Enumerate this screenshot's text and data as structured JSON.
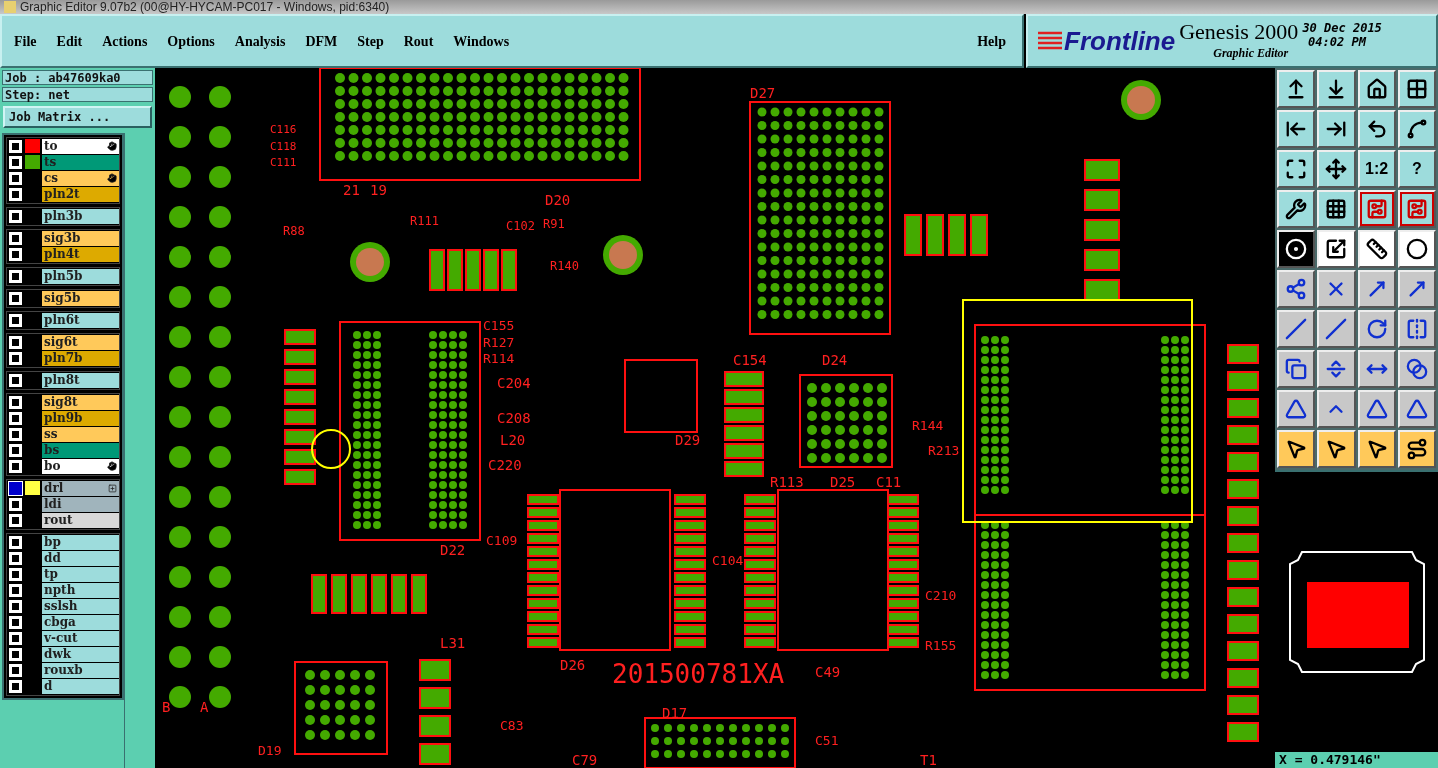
{
  "window": {
    "title": "Graphic Editor 9.07b2 (00@HY-HYCAM-PC017 - Windows, pid:6340)"
  },
  "menu": [
    "File",
    "Edit",
    "Actions",
    "Options",
    "Analysis",
    "DFM",
    "Step",
    "Rout",
    "Windows"
  ],
  "help": "Help",
  "brand": {
    "logo": "Frontline",
    "product": "Genesis 2000",
    "subtitle": "Graphic Editor",
    "date": "30 Dec 2015",
    "time": "04:02 PM"
  },
  "job": {
    "job": "Job : ab47609ka0",
    "step": "Step: net",
    "matrix_button": "Job Matrix ..."
  },
  "layer_groups": [
    {
      "layers": [
        {
          "name": "to",
          "color": "#ffffff",
          "swatch": {
            "color": "#ff0000"
          },
          "marked": true,
          "selected": false,
          "menu": false
        },
        {
          "name": "ts",
          "color": "#009977",
          "swatch": {
            "color": "#44aa00"
          },
          "marked": false,
          "selected": false,
          "menu": false
        },
        {
          "name": "cs",
          "color": "#ffc95a",
          "marked": true,
          "selected": false,
          "menu": false
        },
        {
          "name": "pln2t",
          "color": "#ddaa00",
          "marked": false,
          "selected": false,
          "menu": false
        }
      ]
    },
    {
      "layers": [
        {
          "name": "pln3b",
          "color": "#9ddcdc",
          "marked": false,
          "selected": false,
          "menu": false
        }
      ]
    },
    {
      "layers": [
        {
          "name": "sig3b",
          "color": "#ffc95a",
          "marked": false,
          "selected": false,
          "menu": false
        },
        {
          "name": "pln4t",
          "color": "#ddaa00",
          "marked": false,
          "selected": false,
          "menu": false
        }
      ]
    },
    {
      "layers": [
        {
          "name": "pln5b",
          "color": "#9ddcdc",
          "marked": false,
          "selected": false,
          "menu": false
        }
      ]
    },
    {
      "layers": [
        {
          "name": "sig5b",
          "color": "#ffc95a",
          "marked": false,
          "selected": false,
          "menu": false
        }
      ]
    },
    {
      "layers": [
        {
          "name": "pln6t",
          "color": "#9ddcdc",
          "marked": false,
          "selected": false,
          "menu": false
        }
      ]
    },
    {
      "layers": [
        {
          "name": "sig6t",
          "color": "#ffc95a",
          "marked": false,
          "selected": false,
          "menu": false
        },
        {
          "name": "pln7b",
          "color": "#ddaa00",
          "marked": false,
          "selected": false,
          "menu": false
        }
      ]
    },
    {
      "layers": [
        {
          "name": "pln8t",
          "color": "#9ddcdc",
          "marked": false,
          "selected": false,
          "menu": false
        }
      ]
    },
    {
      "layers": [
        {
          "name": "sig8t",
          "color": "#ffc95a",
          "marked": false,
          "selected": false,
          "menu": false
        },
        {
          "name": "pln9b",
          "color": "#ddaa00",
          "marked": false,
          "selected": false,
          "menu": false
        },
        {
          "name": "ss",
          "color": "#ffc95a",
          "marked": false,
          "selected": false,
          "menu": false
        },
        {
          "name": "bs",
          "color": "#009977",
          "marked": false,
          "selected": false,
          "menu": false
        },
        {
          "name": "bo",
          "color": "#ffffff",
          "marked": true,
          "selected": false,
          "menu": false
        }
      ]
    },
    {
      "layers": [
        {
          "name": "drl",
          "color": "#a0b4bc",
          "swatch": {
            "color": "#ffff44"
          },
          "marked": false,
          "selected": true,
          "menu": true
        },
        {
          "name": "ldi",
          "color": "#a0b4bc",
          "marked": false,
          "selected": false,
          "menu": false
        },
        {
          "name": "rout",
          "color": "#d8d8d8",
          "marked": false,
          "selected": false,
          "menu": false
        }
      ]
    },
    {
      "layers": [
        {
          "name": "bp",
          "color": "#9ddcdc",
          "marked": false,
          "selected": false,
          "menu": false
        },
        {
          "name": "dd",
          "color": "#9ddcdc",
          "marked": false,
          "selected": false,
          "menu": false
        },
        {
          "name": "tp",
          "color": "#9ddcdc",
          "marked": false,
          "selected": false,
          "menu": false
        },
        {
          "name": "npth",
          "color": "#9ddcdc",
          "marked": false,
          "selected": false,
          "menu": false
        },
        {
          "name": "sslsh",
          "color": "#9ddcdc",
          "marked": false,
          "selected": false,
          "menu": false
        },
        {
          "name": "cbga",
          "color": "#9ddcdc",
          "marked": false,
          "selected": false,
          "menu": false
        },
        {
          "name": "v-cut",
          "color": "#9ddcdc",
          "marked": false,
          "selected": false,
          "menu": false
        },
        {
          "name": "dwk",
          "color": "#9ddcdc",
          "marked": false,
          "selected": false,
          "menu": false
        },
        {
          "name": "rouxb",
          "color": "#9ddcdc",
          "marked": false,
          "selected": false,
          "menu": false
        },
        {
          "name": "d",
          "color": "#9ddcdc",
          "marked": false,
          "selected": false,
          "menu": false
        }
      ]
    }
  ],
  "canvas_labels": [
    "C116",
    "C118",
    "C111",
    "21",
    "19",
    "D20",
    "R88",
    "R111",
    "C102",
    "R91",
    "R140",
    "D27",
    "C155",
    "R127",
    "R114",
    "C204",
    "C208",
    "L20",
    "C220",
    "D29",
    "C154",
    "D24",
    "R144",
    "R213",
    "R113",
    "D25",
    "C11",
    "D22",
    "C109",
    "C104",
    "C210",
    "R155",
    "D26",
    "201500781XA",
    "C49",
    "L31",
    "C83",
    "D17",
    "C79",
    "C51",
    "T1",
    "D19",
    "B",
    "A"
  ],
  "toolbar": [
    {
      "kind": "view",
      "selected": false
    },
    {
      "kind": "view",
      "selected": false
    },
    {
      "kind": "view",
      "selected": false
    },
    {
      "kind": "view",
      "selected": false
    },
    {
      "kind": "view",
      "selected": false
    },
    {
      "kind": "view",
      "selected": false
    },
    {
      "kind": "view",
      "selected": false
    },
    {
      "kind": "view",
      "selected": false
    },
    {
      "kind": "view",
      "selected": false
    },
    {
      "kind": "view",
      "selected": false
    },
    {
      "kind": "view",
      "selected": false,
      "label": "1:2"
    },
    {
      "kind": "view",
      "selected": false,
      "label": "?"
    },
    {
      "kind": "view",
      "selected": false
    },
    {
      "kind": "view",
      "selected": false
    },
    {
      "kind": "circuit",
      "selected": false
    },
    {
      "kind": "circuit",
      "selected": false
    },
    {
      "kind": "mode",
      "selected": true
    },
    {
      "kind": "mode",
      "selected": false
    },
    {
      "kind": "mode",
      "selected": false
    },
    {
      "kind": "mode",
      "selected": false
    },
    {
      "kind": "edit",
      "selected": false
    },
    {
      "kind": "edit",
      "selected": false
    },
    {
      "kind": "edit",
      "selected": false
    },
    {
      "kind": "edit",
      "selected": false
    },
    {
      "kind": "edit",
      "selected": false
    },
    {
      "kind": "edit",
      "selected": false
    },
    {
      "kind": "edit",
      "selected": false
    },
    {
      "kind": "edit",
      "selected": false
    },
    {
      "kind": "edit",
      "selected": false
    },
    {
      "kind": "edit",
      "selected": false
    },
    {
      "kind": "edit",
      "selected": false
    },
    {
      "kind": "edit",
      "selected": false
    },
    {
      "kind": "edit",
      "selected": false
    },
    {
      "kind": "edit",
      "selected": false
    },
    {
      "kind": "edit",
      "selected": false
    },
    {
      "kind": "edit",
      "selected": false
    },
    {
      "kind": "select",
      "selected": false
    },
    {
      "kind": "select",
      "selected": false
    },
    {
      "kind": "select",
      "selected": false
    },
    {
      "kind": "select",
      "selected": false
    }
  ],
  "coordinates": "X = 0.479146\""
}
